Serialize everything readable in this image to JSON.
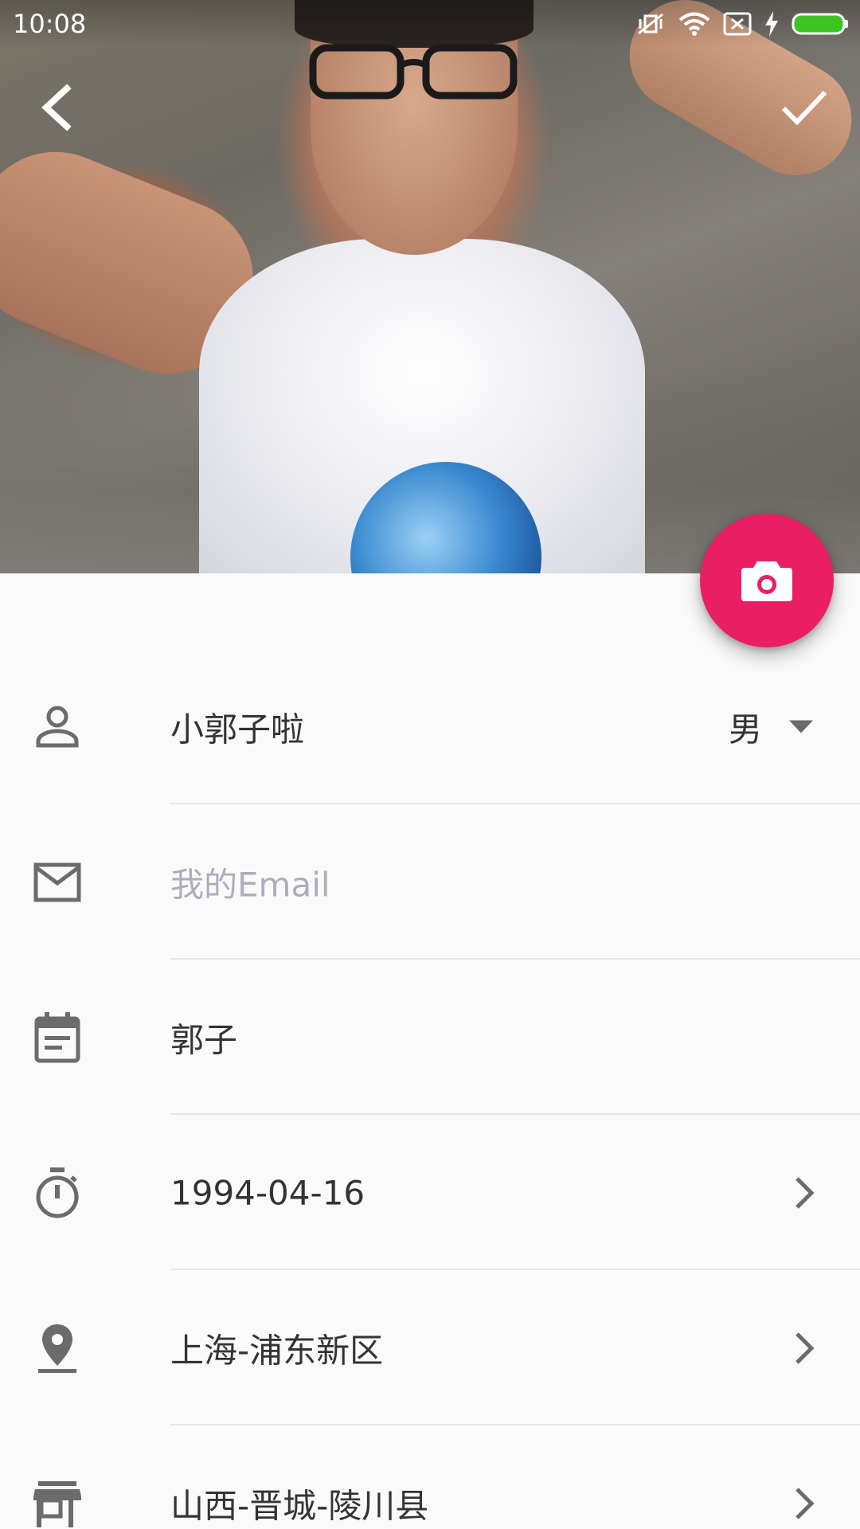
{
  "status_bar": {
    "time": "10:08",
    "icons": [
      "vibrate-off-icon",
      "wifi-icon",
      "no-sim-icon",
      "charging-icon",
      "battery-icon"
    ]
  },
  "toolbar": {
    "back_icon": "back-arrow-icon",
    "done_icon": "check-icon"
  },
  "fab": {
    "icon": "camera-icon",
    "color": "#e91e63"
  },
  "form": {
    "nickname": "小郭子啦",
    "gender": "男",
    "email_placeholder": "我的Email",
    "signature": "郭子",
    "birthday": "1994-04-16",
    "location": "上海-浦东新区",
    "hometown": "山西-晋城-陵川县"
  },
  "colors": {
    "accent": "#e91e63",
    "icon_gray": "#6b6b6b",
    "text": "#333333",
    "placeholder": "#b0abbd"
  }
}
